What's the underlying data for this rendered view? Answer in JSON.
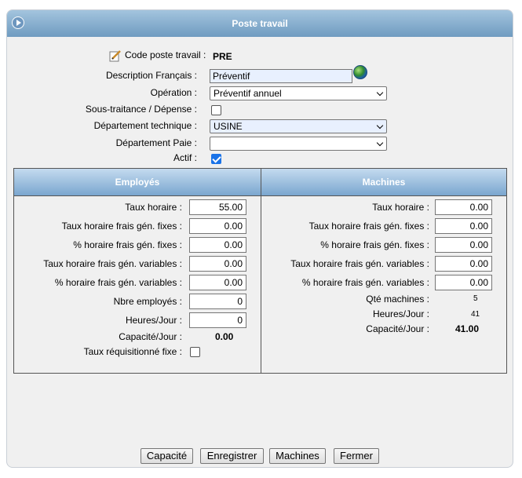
{
  "window": {
    "title": "Poste travail"
  },
  "form": {
    "code": {
      "label": "Code poste travail :",
      "value": "PRE"
    },
    "description": {
      "label": "Description Français :",
      "value": "Préventif"
    },
    "operation": {
      "label": "Opération :",
      "value": "Préventif annuel"
    },
    "sous_traitance": {
      "label": "Sous-traitance / Dépense :",
      "checked": false
    },
    "dept_technique": {
      "label": "Département technique :",
      "value": "USINE"
    },
    "dept_paie": {
      "label": "Département Paie :",
      "value": ""
    },
    "actif": {
      "label": "Actif :",
      "checked": true
    }
  },
  "employes": {
    "title": "Employés",
    "taux_horaire": {
      "label": "Taux horaire :",
      "value": "55.00"
    },
    "taux_fixes": {
      "label": "Taux horaire frais gén. fixes :",
      "value": "0.00"
    },
    "pct_fixes": {
      "label": "% horaire frais gén. fixes :",
      "value": "0.00"
    },
    "taux_variables": {
      "label": "Taux horaire frais gén. variables :",
      "value": "0.00"
    },
    "pct_variables": {
      "label": "% horaire frais gén. variables :",
      "value": "0.00"
    },
    "nbre_employes": {
      "label": "Nbre employés :",
      "value": "0"
    },
    "heures_jour": {
      "label": "Heures/Jour :",
      "value": "0"
    },
    "capacite_jour": {
      "label": "Capacité/Jour :",
      "value": "0.00"
    },
    "taux_requisitionne": {
      "label": "Taux réquisitionné fixe :",
      "checked": false
    }
  },
  "machines": {
    "title": "Machines",
    "taux_horaire": {
      "label": "Taux horaire :",
      "value": "0.00"
    },
    "taux_fixes": {
      "label": "Taux horaire frais gén. fixes :",
      "value": "0.00"
    },
    "pct_fixes": {
      "label": "% horaire frais gén. fixes :",
      "value": "0.00"
    },
    "taux_variables": {
      "label": "Taux horaire frais gén. variables :",
      "value": "0.00"
    },
    "pct_variables": {
      "label": "% horaire frais gén. variables :",
      "value": "0.00"
    },
    "qte_machines": {
      "label": "Qté machines :",
      "value": "5"
    },
    "heures_jour": {
      "label": "Heures/Jour :",
      "value": "41"
    },
    "capacite_jour": {
      "label": "Capacité/Jour :",
      "value": "41.00"
    }
  },
  "buttons": {
    "capacite": "Capacité",
    "enregistrer": "Enregistrer",
    "machines": "Machines",
    "fermer": "Fermer"
  },
  "colors": {
    "header_blue": "#6f9bc0",
    "input_highlight": "#e8f0fe",
    "check_blue": "#1a73e8"
  }
}
